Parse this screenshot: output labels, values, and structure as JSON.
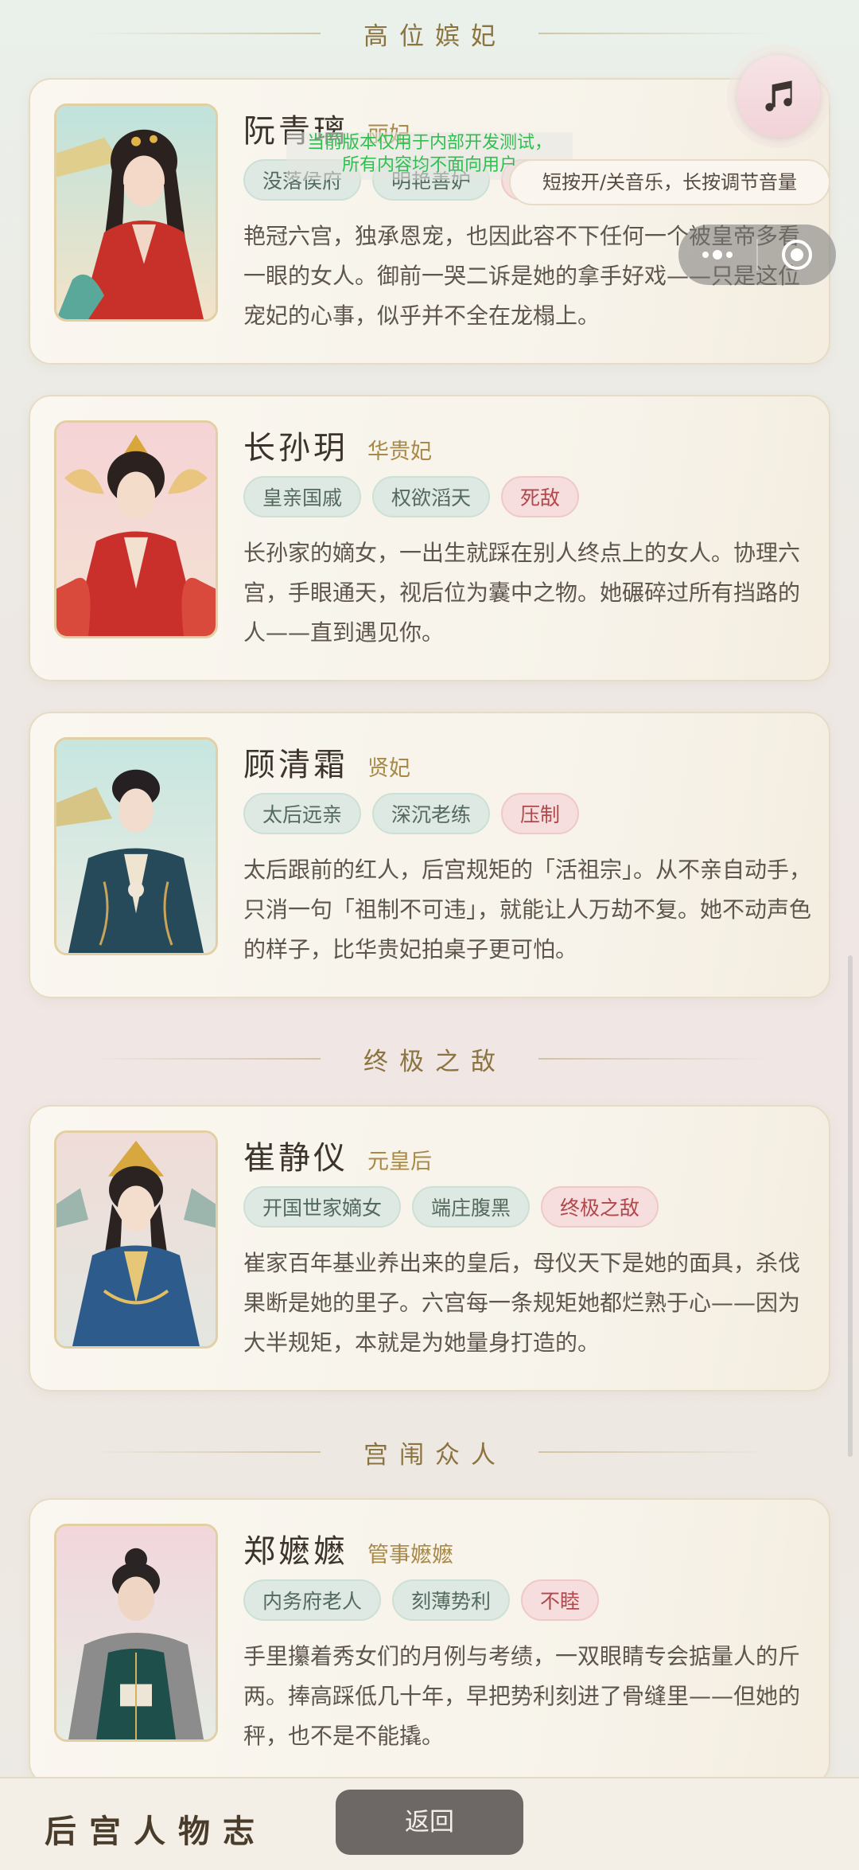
{
  "sections": [
    {
      "title": "高位嫔妃"
    },
    {
      "title": "终极之敌"
    },
    {
      "title": "宫闱众人"
    }
  ],
  "characters": [
    {
      "name": "阮青璃",
      "title": "丽妃",
      "tags": [
        "没落侯府",
        "明艳善妒",
        "争宠"
      ],
      "desc": "艳冠六宫，独承恩宠，也因此容不下任何一个被皇帝多看一眼的女人。御前一哭二诉是她的拿手好戏——只是这位宠妃的心事，似乎并不全在龙榻上。"
    },
    {
      "name": "长孙玥",
      "title": "华贵妃",
      "tags": [
        "皇亲国戚",
        "权欲滔天",
        "死敌"
      ],
      "desc": "长孙家的嫡女，一出生就踩在别人终点上的女人。协理六宫，手眼通天，视后位为囊中之物。她碾碎过所有挡路的人——直到遇见你。"
    },
    {
      "name": "顾清霜",
      "title": "贤妃",
      "tags": [
        "太后远亲",
        "深沉老练",
        "压制"
      ],
      "desc": "太后跟前的红人，后宫规矩的「活祖宗」。从不亲自动手，只消一句「祖制不可违」，就能让人万劫不复。她不动声色的样子，比华贵妃拍桌子更可怕。"
    },
    {
      "name": "崔静仪",
      "title": "元皇后",
      "tags": [
        "开国世家嫡女",
        "端庄腹黑",
        "终极之敌"
      ],
      "desc": "崔家百年基业养出来的皇后，母仪天下是她的面具，杀伐果断是她的里子。六宫每一条规矩她都烂熟于心——因为大半规矩，本就是为她量身打造的。"
    },
    {
      "name": "郑嬷嬷",
      "title": "管事嬷嬷",
      "tags": [
        "内务府老人",
        "刻薄势利",
        "不睦"
      ],
      "desc": "手里攥着秀女们的月例与考绩，一双眼睛专会掂量人的斤两。捧高踩低几十年，早把势利刻进了骨缝里——但她的秤，也不是不能撬。"
    }
  ],
  "overlay": {
    "music_tooltip": "短按开/关音乐，长按调节音量",
    "dev_notice_line1": "当前版本仅用于内部开发测试，",
    "dev_notice_line2": "所有内容均不面向用户"
  },
  "bottom_bar": {
    "brand": "后宫人物志",
    "back_label": "返回"
  },
  "colors": {
    "accent_gold": "#8c7440",
    "tag_green_bg": "#dde9e2",
    "tag_red_bg": "#f7dede",
    "back_button": "#6d6865"
  }
}
